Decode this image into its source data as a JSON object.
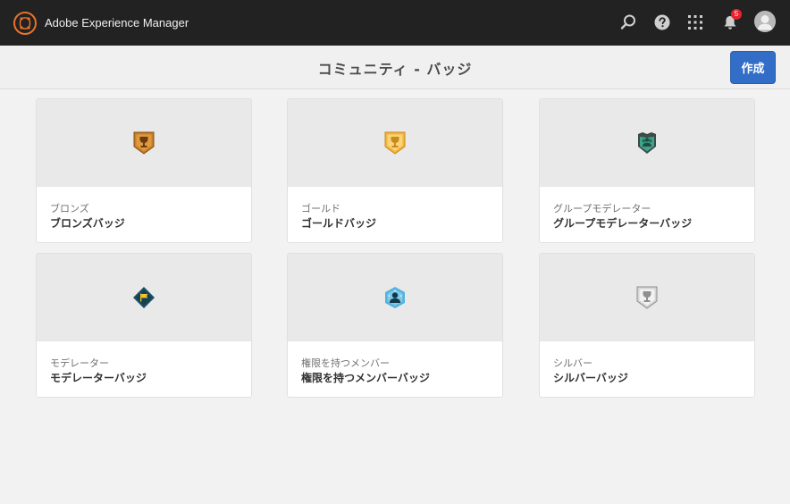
{
  "app": {
    "name": "Adobe Experience Manager"
  },
  "header": {
    "notifications_count": "5",
    "icons": [
      "search-icon",
      "help-icon",
      "apps-grid-icon",
      "bell-icon",
      "avatar"
    ]
  },
  "page": {
    "title": "コミュニティ - バッジ",
    "create_label": "作成"
  },
  "cards": [
    {
      "subtitle": "ブロンズ",
      "title": "ブロンズバッジ",
      "icon": "bronze-badge-icon",
      "color": "#c47d2b"
    },
    {
      "subtitle": "ゴールド",
      "title": "ゴールドバッジ",
      "icon": "gold-badge-icon",
      "color": "#f7c04f"
    },
    {
      "subtitle": "グループモデレーター",
      "title": "グループモデレーターバッジ",
      "icon": "group-moderator-badge-icon",
      "color": "#3fa58a"
    },
    {
      "subtitle": "モデレーター",
      "title": "モデレーターバッジ",
      "icon": "moderator-badge-icon",
      "color": "#1d4f63"
    },
    {
      "subtitle": "権限を持つメンバー",
      "title": "権限を持つメンバーバッジ",
      "icon": "privileged-member-badge-icon",
      "color": "#55b3dd"
    },
    {
      "subtitle": "シルバー",
      "title": "シルバーバッジ",
      "icon": "silver-badge-icon",
      "color": "#c9c9c9"
    }
  ]
}
